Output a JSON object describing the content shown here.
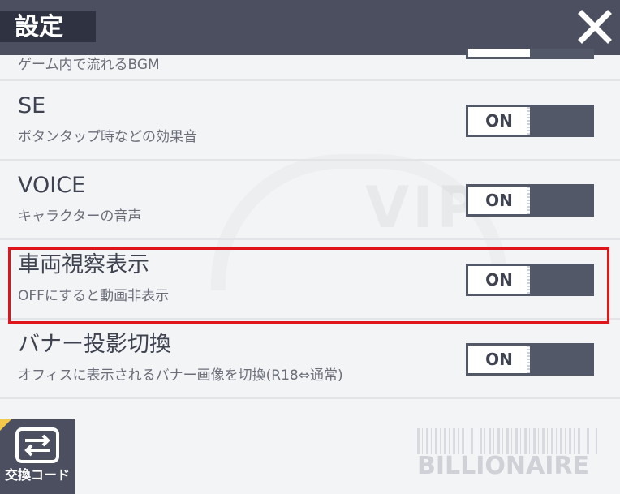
{
  "header": {
    "title": "設定"
  },
  "partial_row": {
    "desc": "ゲーム内で流れるBGM"
  },
  "settings": [
    {
      "title": "SE",
      "desc": "ボタンタップ時などの効果音",
      "toggle": "ON"
    },
    {
      "title": "VOICE",
      "desc": "キャラクターの音声",
      "toggle": "ON"
    },
    {
      "title": "車両視察表示",
      "desc": "OFFにすると動画非表示",
      "toggle": "ON"
    },
    {
      "title": "バナー投影切換",
      "desc": "オフィスに表示されるバナー画像を切換(R18⇔通常)",
      "toggle": "ON"
    }
  ],
  "bottom": {
    "exchange_label": "交換コード",
    "brand": "BILLIONAIRE"
  },
  "colors": {
    "header": "#4b4f5f",
    "toggle": "#535868",
    "highlight": "#e0141b",
    "background": "#f3f4f6"
  }
}
